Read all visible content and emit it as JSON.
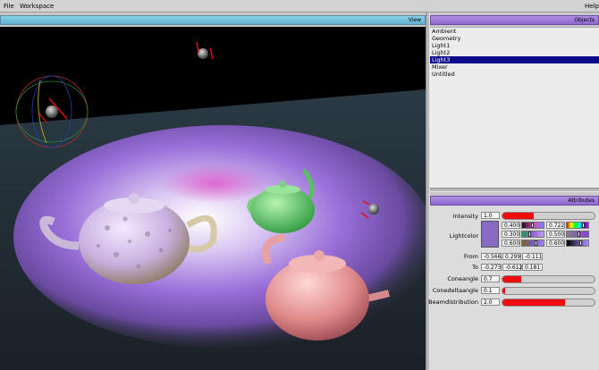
{
  "menubar": {
    "file": "File",
    "workspace": "Workspace",
    "help": "Help"
  },
  "view_panel": {
    "title": "View"
  },
  "objects_panel": {
    "title": "Objects",
    "items": [
      {
        "label": "Ambient",
        "selected": false
      },
      {
        "label": "Geometry",
        "selected": false
      },
      {
        "label": "Light1",
        "selected": false
      },
      {
        "label": "Light2",
        "selected": false
      },
      {
        "label": "Light3",
        "selected": true
      },
      {
        "label": "Mixer",
        "selected": false
      },
      {
        "label": "Untitled",
        "selected": false
      }
    ]
  },
  "attributes_panel": {
    "title": "Attributes",
    "intensity": {
      "label": "Intensity",
      "value": "1.0",
      "level": 0.34
    },
    "lightcolor": {
      "label": "Lightcolor",
      "swatch": "#8a6bc4",
      "rows": [
        {
          "a": "0.400",
          "b": "0.722"
        },
        {
          "a": "0.300",
          "b": "0.500"
        },
        {
          "a": "0.600",
          "b": "0.600"
        }
      ]
    },
    "from": {
      "label": "From",
      "x": "-0.566",
      "y": "0.299",
      "z": "-0.111"
    },
    "to": {
      "label": "To",
      "x": "-0.273",
      "y": "-0.612",
      "z": "0.181"
    },
    "coneangle": {
      "label": "Coneangle",
      "value": "0.7",
      "level": 0.2
    },
    "conedeltaangle": {
      "label": "Conedeltaangle",
      "value": "0.1",
      "level": 0.03
    },
    "beamdistribution": {
      "label": "Beamdistribution",
      "value": "2.0",
      "level": 0.68
    }
  },
  "colors": {
    "accent_selection": "#0b0b8a",
    "slider_fill": "#f00c0c",
    "title_blue": "#6fbcd8",
    "title_purple": "#9b77d8"
  }
}
